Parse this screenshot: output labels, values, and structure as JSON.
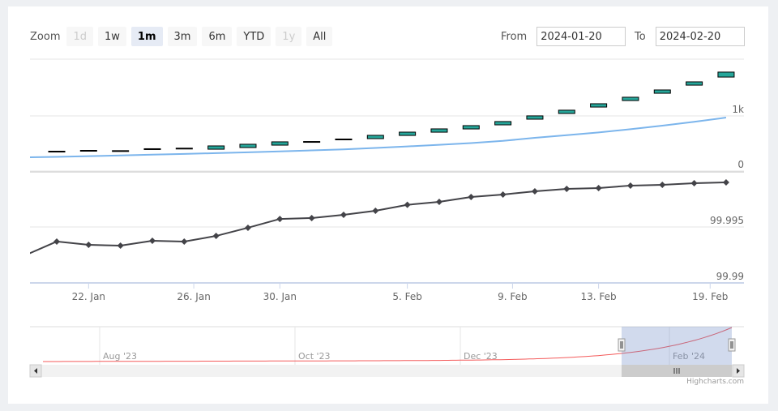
{
  "range_selector": {
    "zoom_label": "Zoom",
    "buttons": [
      {
        "label": "1d",
        "state": "disabled"
      },
      {
        "label": "1w",
        "state": "normal"
      },
      {
        "label": "1m",
        "state": "selected"
      },
      {
        "label": "3m",
        "state": "normal"
      },
      {
        "label": "6m",
        "state": "normal"
      },
      {
        "label": "YTD",
        "state": "normal"
      },
      {
        "label": "1y",
        "state": "disabled"
      },
      {
        "label": "All",
        "state": "normal"
      }
    ],
    "from_label": "From",
    "from_value": "2024-01-20",
    "to_label": "To",
    "to_value": "2024-02-20"
  },
  "credit": "Highcharts.com",
  "chart_data": {
    "type": "line",
    "x_axis": {
      "type": "ordinal-datetime",
      "ticks": [
        {
          "label": "22. Jan",
          "at": 1
        },
        {
          "label": "26. Jan",
          "at": 4.3
        },
        {
          "label": "30. Jan",
          "at": 7
        },
        {
          "label": "5. Feb",
          "at": 11
        },
        {
          "label": "9. Feb",
          "at": 14.3
        },
        {
          "label": "13. Feb",
          "at": 17
        },
        {
          "label": "19. Feb",
          "at": 20.5
        }
      ]
    },
    "upper_pane": {
      "ylim": [
        0,
        2000
      ],
      "y_ticks": [
        {
          "value": 0,
          "label": "0"
        },
        {
          "value": 1000,
          "label": "1k"
        }
      ],
      "candlestick": {
        "up_color": "#26a69a",
        "down_color": "#000000",
        "points": [
          {
            "open": 360,
            "close": 346
          },
          {
            "open": 375,
            "close": 361
          },
          {
            "open": 370,
            "close": 366
          },
          {
            "open": 405,
            "close": 390
          },
          {
            "open": 415,
            "close": 409
          },
          {
            "open": 396,
            "close": 456
          },
          {
            "open": 426,
            "close": 486
          },
          {
            "open": 470,
            "close": 530
          },
          {
            "open": 536,
            "close": 522
          },
          {
            "open": 581,
            "close": 567
          },
          {
            "open": 588,
            "close": 648
          },
          {
            "open": 646,
            "close": 706
          },
          {
            "open": 705,
            "close": 765
          },
          {
            "open": 764,
            "close": 824
          },
          {
            "open": 838,
            "close": 898
          },
          {
            "open": 941,
            "close": 1001
          },
          {
            "open": 1044,
            "close": 1104
          },
          {
            "open": 1161,
            "close": 1221
          },
          {
            "open": 1279,
            "close": 1339
          },
          {
            "open": 1411,
            "close": 1471
          },
          {
            "open": 1558,
            "close": 1618
          },
          {
            "open": 1705,
            "close": 1795
          }
        ]
      },
      "line": {
        "color": "#7cb5ec",
        "start": 250,
        "values": [
          258,
          270,
          283,
          297,
          311,
          325,
          340,
          357,
          375,
          394,
          420,
          447,
          476,
          507,
          547,
          603,
          650,
          700,
          760,
          824,
          893,
          970
        ]
      }
    },
    "lower_pane": {
      "ylim": [
        99.99,
        100.0
      ],
      "y_ticks": [
        {
          "value": 99.995,
          "label": "99.995"
        },
        {
          "value": 99.99,
          "label": "99.99"
        }
      ],
      "line": {
        "color": "#434348",
        "marker": "diamond",
        "previous": 99.99246,
        "values": [
          99.9937,
          99.99341,
          99.99333,
          99.99377,
          99.9937,
          99.9942,
          99.99493,
          99.99572,
          99.9958,
          99.99609,
          99.99645,
          99.99698,
          99.99725,
          99.99768,
          99.9979,
          99.99819,
          99.99841,
          99.99848,
          99.9987,
          99.99877,
          99.99891,
          99.99899
        ]
      }
    },
    "navigator": {
      "series_color": "#f45b5b",
      "labels": [
        "Aug '23",
        "Oct '23",
        "Dec '23",
        "Feb '24"
      ],
      "selected_range": [
        "2024-01-20",
        "2024-02-20"
      ]
    }
  }
}
